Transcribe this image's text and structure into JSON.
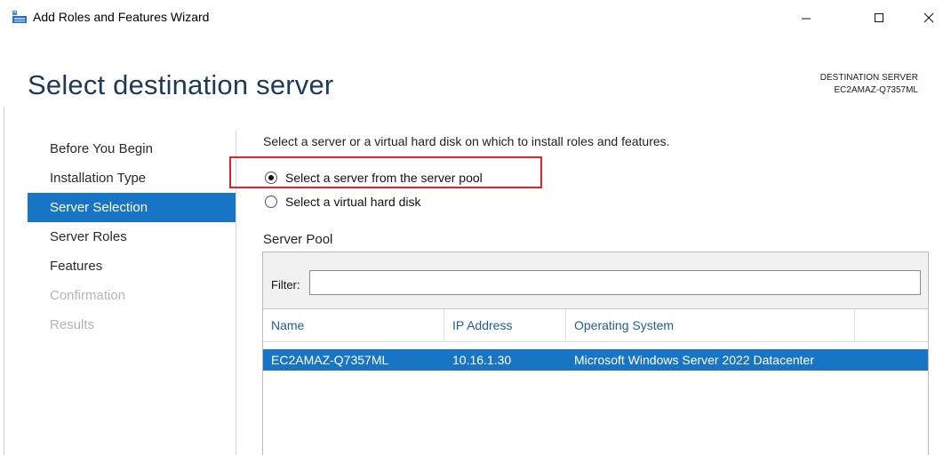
{
  "window": {
    "title": "Add Roles and Features Wizard",
    "icon": "server-manager-icon",
    "controls": [
      "minimize-icon",
      "maximize-icon",
      "close-icon"
    ]
  },
  "header": {
    "title": "Select destination server",
    "destination_label": "DESTINATION SERVER",
    "destination_value": "EC2AMAZ-Q7357ML"
  },
  "nav": {
    "items": [
      {
        "label": "Before You Begin",
        "state": "normal"
      },
      {
        "label": "Installation Type",
        "state": "normal"
      },
      {
        "label": "Server Selection",
        "state": "active"
      },
      {
        "label": "Server Roles",
        "state": "normal"
      },
      {
        "label": "Features",
        "state": "normal"
      },
      {
        "label": "Confirmation",
        "state": "disabled"
      },
      {
        "label": "Results",
        "state": "disabled"
      }
    ]
  },
  "content": {
    "instruction": "Select a server or a virtual hard disk on which to install roles and features.",
    "options": [
      {
        "label": "Select a server from the server pool",
        "selected": true
      },
      {
        "label": "Select a virtual hard disk",
        "selected": false
      }
    ],
    "pool_label": "Server Pool",
    "filter_label": "Filter:",
    "filter_value": "",
    "columns": [
      "Name",
      "IP Address",
      "Operating System"
    ],
    "rows": [
      {
        "name": "EC2AMAZ-Q7357ML",
        "ip": "10.16.1.30",
        "os": "Microsoft Windows Server 2022 Datacenter",
        "selected": true
      }
    ]
  },
  "colors": {
    "accent": "#1874c4",
    "title": "#1e3a5a",
    "highlight": "#e0222a",
    "column_header": "#1f5c9e"
  }
}
